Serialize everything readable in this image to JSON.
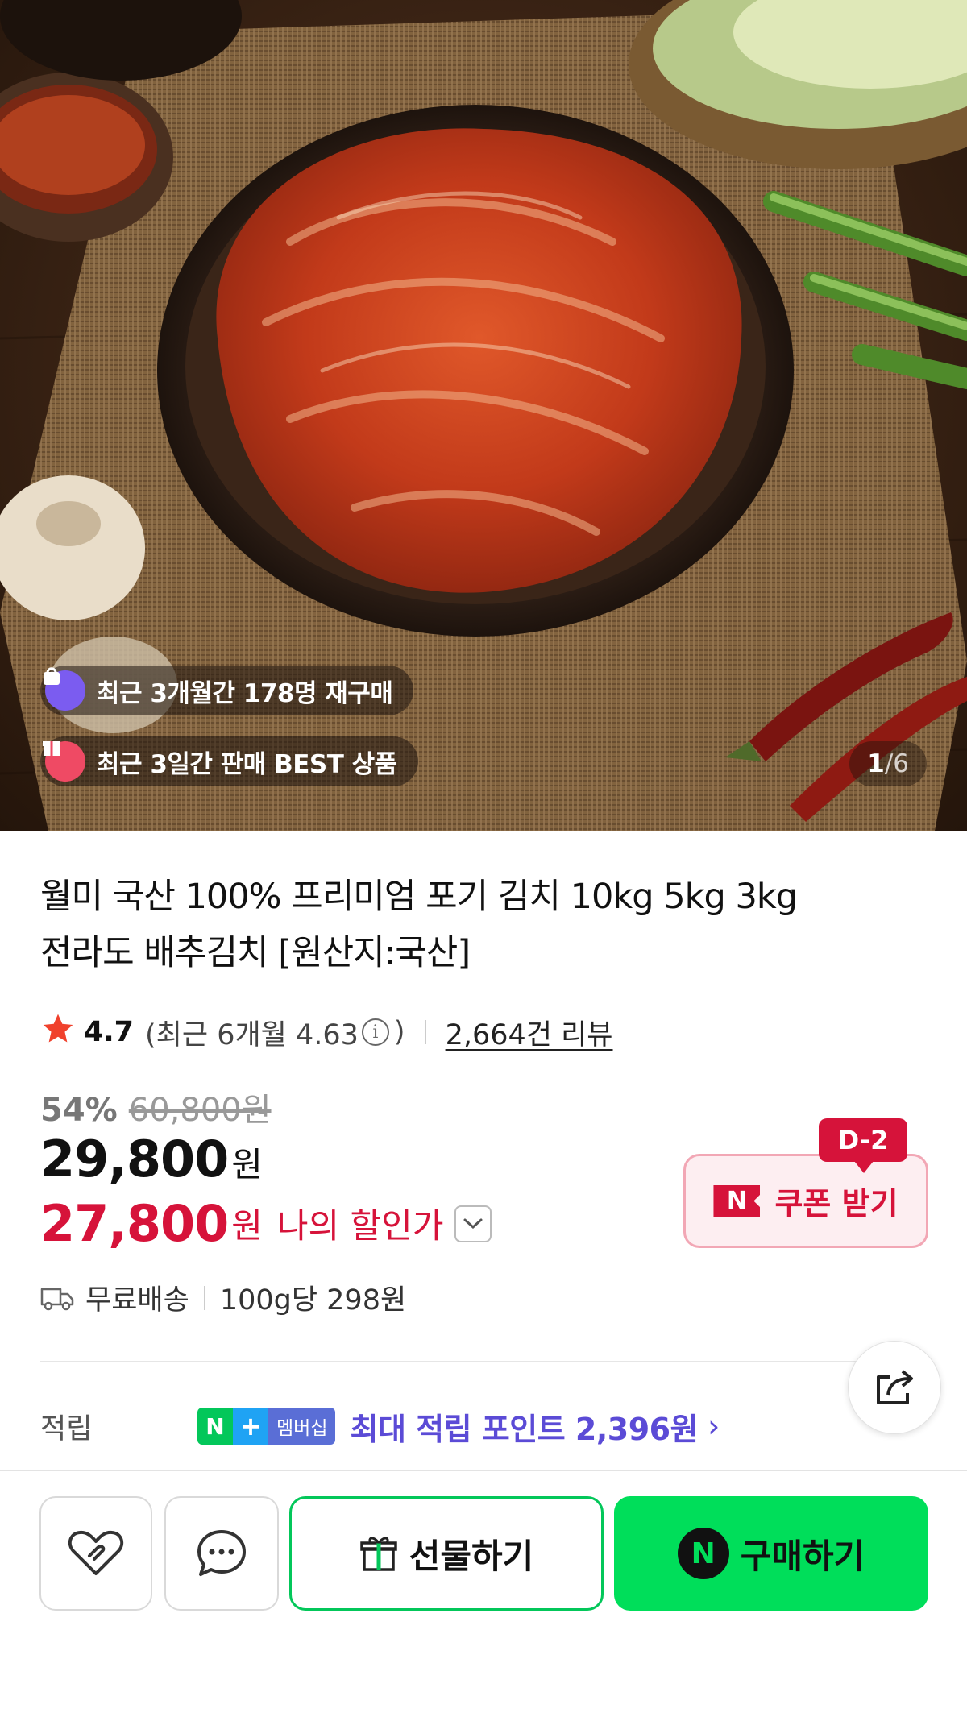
{
  "hero": {
    "badges": [
      {
        "text": "최근 3개월간 178명 재구매",
        "icon": "shopping-bag-icon",
        "color": "#7b5cf0"
      },
      {
        "text": "최근 3일간 판매 BEST 상품",
        "icon": "gift-box-icon",
        "color": "#ef4a64"
      }
    ],
    "counter": {
      "current": "1",
      "separator": "/",
      "total": "6"
    }
  },
  "product": {
    "title_line1": "월미 국산 100% 프리미엄 포기 김치 10kg 5kg 3kg",
    "title_line2": "전라도 배추김치 [원산지:국산]",
    "rating": "4.7",
    "recent_rating_prefix": "(최근 6개월 4.63",
    "recent_rating_suffix": ")",
    "review_count": "2,664건 리뷰",
    "discount_rate": "54%",
    "original_price": "60,800원",
    "price": "29,800",
    "price_unit": "원",
    "my_price": "27,800",
    "my_price_unit": "원",
    "my_price_label": "나의 할인가",
    "shipping": "무료배송",
    "unit_price": "100g당 298원"
  },
  "coupon": {
    "d_day": "D-2",
    "n_logo": "N",
    "label": "쿠폰 받기",
    "color": "#d6133a"
  },
  "points": {
    "label": "적립",
    "badge_n": "N",
    "badge_plus": "+",
    "badge_membership": "멤버십",
    "text": "최대 적립 포인트 2,396원",
    "arrow": "›"
  },
  "actions": {
    "gift_label": "선물하기",
    "buy_logo": "N",
    "buy_label": "구매하기",
    "buy_color": "#00de5a"
  }
}
